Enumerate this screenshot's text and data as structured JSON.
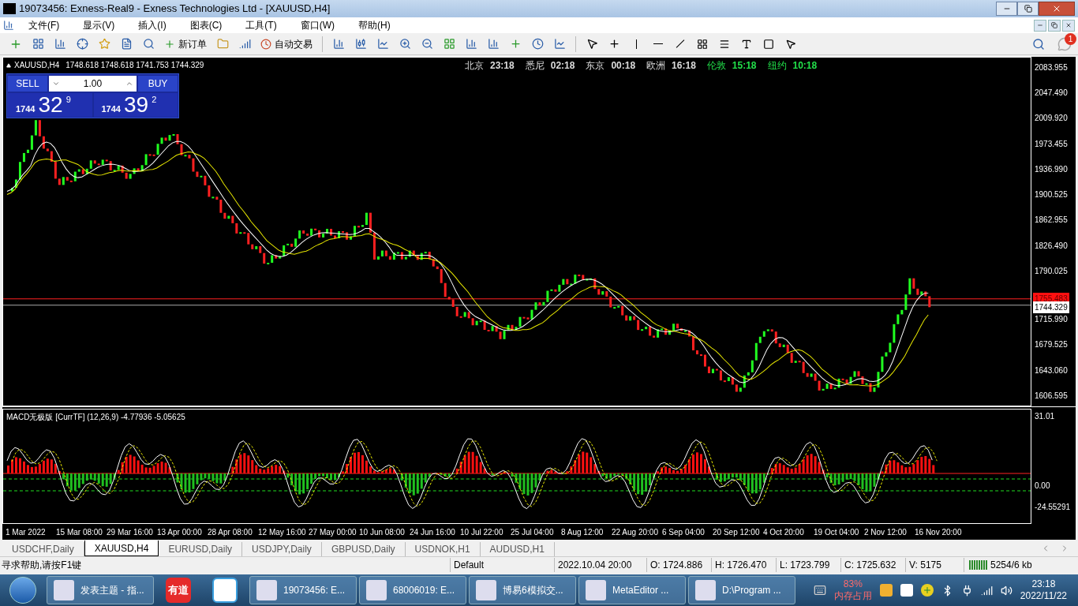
{
  "window": {
    "title": "19073456: Exness-Real9 - Exness Technologies Ltd - [XAUUSD,H4]"
  },
  "menu": [
    "文件(F)",
    "显示(V)",
    "插入(I)",
    "图表(C)",
    "工具(T)",
    "窗口(W)",
    "帮助(H)"
  ],
  "notification_count": "1",
  "toolbar": {
    "new_order": "新订单",
    "auto_trading": "自动交易"
  },
  "chart": {
    "symbol": "XAUUSD,H4",
    "ohlc": "1748.618 1748.618 1741.753 1744.329",
    "clocks": [
      {
        "city": "北京",
        "time": "23:18",
        "highlighted": false
      },
      {
        "city": "悉尼",
        "time": "02:18",
        "highlighted": false
      },
      {
        "city": "东京",
        "time": "00:18",
        "highlighted": false
      },
      {
        "city": "欧洲",
        "time": "16:18",
        "highlighted": false
      },
      {
        "city": "伦敦",
        "time": "15:18",
        "highlighted": true
      },
      {
        "city": "纽约",
        "time": "10:18",
        "highlighted": true
      }
    ],
    "trade_panel": {
      "sell": "SELL",
      "buy": "BUY",
      "lot": "1.00",
      "sell_price": {
        "prefix": "1744",
        "big": "32",
        "sup": "9"
      },
      "buy_price": {
        "prefix": "1744",
        "big": "39",
        "sup": "2"
      }
    },
    "price_axis": [
      "2083.955",
      "2047.490",
      "2009.920",
      "1973.455",
      "1936.990",
      "1900.525",
      "1862.955",
      "1826.490",
      "1790.025",
      "1715.990",
      "1679.525",
      "1643.060",
      "1606.595"
    ],
    "marker_price": "1755.483",
    "current_price": "1744.329"
  },
  "macd": {
    "title": "MACD无极版 [CurrTF] (12,26,9) -4.77936 -5.05625",
    "axis": [
      "31.01",
      "0.00",
      "-24.55291"
    ]
  },
  "time_axis": [
    "1 Mar 2022",
    "15 Mar 08:00",
    "29 Mar 16:00",
    "13 Apr 00:00",
    "28 Apr 08:00",
    "12 May 16:00",
    "27 May 00:00",
    "10 Jun 08:00",
    "24 Jun 16:00",
    "10 Jul 22:00",
    "25 Jul 04:00",
    "8 Aug 12:00",
    "22 Aug 20:00",
    "6 Sep 04:00",
    "20 Sep 12:00",
    "4 Oct 20:00",
    "19 Oct 04:00",
    "2 Nov 12:00",
    "16 Nov 20:00"
  ],
  "tabs": [
    {
      "label": "USDCHF,Daily",
      "selected": false
    },
    {
      "label": "XAUUSD,H4",
      "selected": true
    },
    {
      "label": "EURUSD,Daily",
      "selected": false
    },
    {
      "label": "USDJPY,Daily",
      "selected": false
    },
    {
      "label": "GBPUSD,Daily",
      "selected": false
    },
    {
      "label": "USDNOK,H1",
      "selected": false
    },
    {
      "label": "AUDUSD,H1",
      "selected": false
    }
  ],
  "status_bar": {
    "help": "寻求帮助,请按F1键",
    "profile": "Default",
    "datetime": "2022.10.04 20:00",
    "open": "O: 1724.886",
    "high": "H: 1726.470",
    "low": "L: 1723.799",
    "close": "C: 1725.632",
    "volume": "V: 5175",
    "traffic": "5254/6 kb"
  },
  "taskbar": {
    "items": [
      {
        "kind": "app",
        "label": "发表主题 - 指..."
      },
      {
        "kind": "logo",
        "label": "有道"
      },
      {
        "kind": "icon"
      },
      {
        "kind": "app",
        "label": "19073456: E..."
      },
      {
        "kind": "app",
        "label": "68006019: E..."
      },
      {
        "kind": "app",
        "label": "博易6模拟交..."
      },
      {
        "kind": "app",
        "label": "MetaEditor ..."
      },
      {
        "kind": "app",
        "label": "D:\\Program ..."
      }
    ],
    "memory_percent": "83%",
    "memory_label": "内存占用",
    "time": "23:18",
    "date": "2022/11/22"
  }
}
